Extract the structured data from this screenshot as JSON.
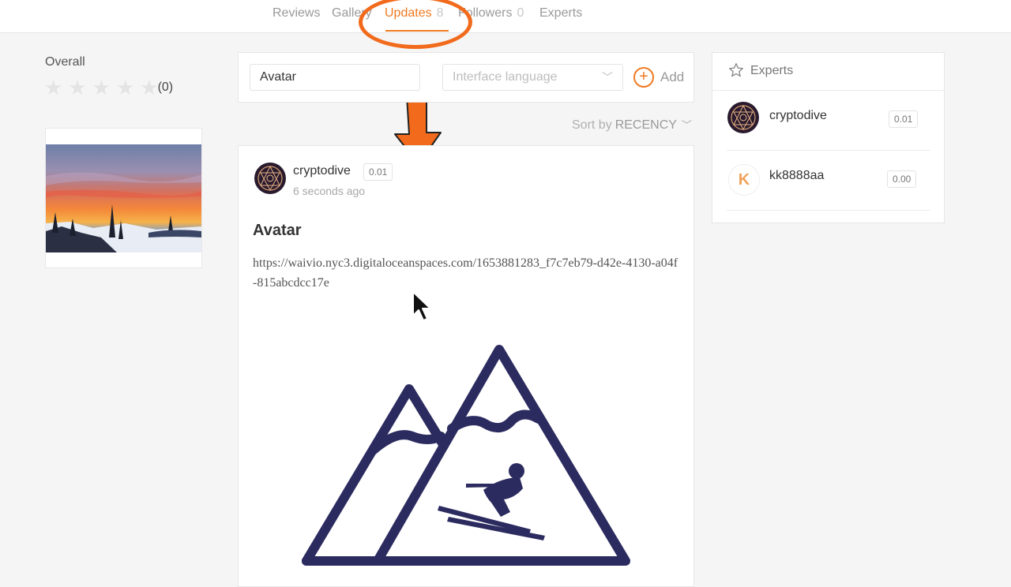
{
  "tabs": [
    {
      "label": "Reviews",
      "count": ""
    },
    {
      "label": "Gallery",
      "count": ""
    },
    {
      "label": "Updates",
      "count": "8"
    },
    {
      "label": "Followers",
      "count": "0"
    },
    {
      "label": "Experts",
      "count": ""
    }
  ],
  "active_tab": "Updates",
  "sidebar": {
    "overall_label": "Overall",
    "rating_count": "(0)",
    "rating_stars": 0,
    "max_stars": 5
  },
  "filter": {
    "input_value": "Avatar",
    "language_placeholder": "Interface language",
    "add_label": "Add"
  },
  "sort": {
    "label": "Sort by",
    "value": "RECENCY"
  },
  "post": {
    "author": "cryptodive",
    "reputation": "0.01",
    "time": "6 seconds ago",
    "title": "Avatar",
    "body": "https://waivio.nyc3.digitaloceanspaces.com/1653881283_f7c7eb79-d42e-4130-a04f-815abcdcc17e"
  },
  "experts": {
    "title": "Experts",
    "list": [
      {
        "name": "cryptodive",
        "score": "0.01",
        "avatar": "network-avatar"
      },
      {
        "name": "kk8888aa",
        "score": "0.00",
        "avatar": "letter-k-avatar",
        "initial": "K"
      }
    ]
  },
  "colors": {
    "accent": "#f07a22",
    "annotation": "#f26a1b",
    "logo_navy": "#2c2b5f"
  }
}
